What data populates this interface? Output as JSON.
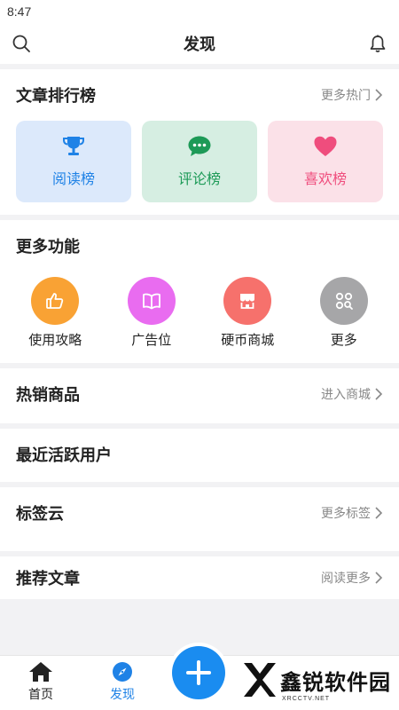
{
  "status_bar": {
    "time": "8:47"
  },
  "header": {
    "title": "发现",
    "search_icon": "search-icon",
    "bell_icon": "bell-icon"
  },
  "article_rank": {
    "title": "文章排行榜",
    "more": "更多热门",
    "cards": [
      {
        "label": "阅读榜",
        "icon": "trophy-icon",
        "color": "#1f82e6"
      },
      {
        "label": "评论榜",
        "icon": "chat-icon",
        "color": "#1d9a57"
      },
      {
        "label": "喜欢榜",
        "icon": "heart-icon",
        "color": "#ef4d7d"
      }
    ]
  },
  "more_functions": {
    "title": "更多功能",
    "items": [
      {
        "label": "使用攻略",
        "icon": "thumbs-up-icon",
        "color": "#f9a234"
      },
      {
        "label": "广告位",
        "icon": "book-icon",
        "color": "#e96cf0"
      },
      {
        "label": "硬币商城",
        "icon": "shop-icon",
        "color": "#f6716c"
      },
      {
        "label": "更多",
        "icon": "grid-search-icon",
        "color": "#a6a6a8"
      }
    ]
  },
  "hot_products": {
    "title": "热销商品",
    "more": "进入商城"
  },
  "active_users": {
    "title": "最近活跃用户"
  },
  "tag_cloud": {
    "title": "标签云",
    "more": "更多标签"
  },
  "recommended": {
    "title": "推荐文章",
    "more": "阅读更多"
  },
  "bottom_nav": {
    "items": [
      {
        "label": "首页",
        "icon": "home-icon"
      },
      {
        "label": "发现",
        "icon": "compass-icon",
        "active": true
      }
    ],
    "fab_icon": "plus-icon",
    "accent": "#1f82e6"
  },
  "watermark": {
    "text": "鑫锐软件园",
    "sub": "XRCCTV.NET"
  }
}
